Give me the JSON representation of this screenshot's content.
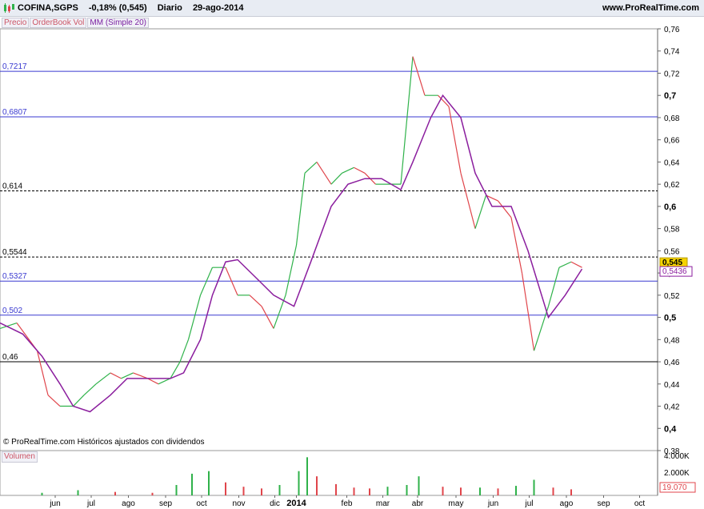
{
  "header": {
    "symbol": "COFINA,SGPS",
    "change": "-0,18% (0,545)",
    "period": "Diario",
    "date": "29-ago-2014",
    "site": "www.ProRealTime.com"
  },
  "tabs": [
    "Precio",
    "OrderBook Vol",
    "MM (Simple 20)"
  ],
  "credit": "© ProRealTime.com  Históricos ajustados con dividendos",
  "volume_tab": "Volumen",
  "colors": {
    "up": "#2fb24a",
    "down": "#e0454b",
    "ma": "#8b1e9e",
    "level": "#3a3ad0",
    "last": "#f5d400"
  },
  "chart_data": {
    "type": "line",
    "title": "COFINA,SGPS",
    "price_axis": {
      "min": 0.38,
      "max": 0.76,
      "ticks": [
        "0,76",
        "0,74",
        "0,72",
        "0,7",
        "0,68",
        "0,66",
        "0,64",
        "0,62",
        "0,6",
        "0,58",
        "0,56",
        "0,54",
        "0,52",
        "0,5",
        "0,48",
        "0,46",
        "0,44",
        "0,42",
        "0,4",
        "0,38"
      ],
      "tick_values": [
        0.76,
        0.74,
        0.72,
        0.7,
        0.68,
        0.66,
        0.64,
        0.62,
        0.6,
        0.58,
        0.56,
        0.54,
        0.52,
        0.5,
        0.48,
        0.46,
        0.44,
        0.42,
        0.4,
        0.38
      ]
    },
    "x_axis": {
      "labels": [
        "jun",
        "jul",
        "ago",
        "sep",
        "oct",
        "nov",
        "dic",
        "2014",
        "feb",
        "mar",
        "abr",
        "may",
        "jun",
        "jul",
        "ago",
        "sep",
        "oct"
      ],
      "range": [
        "2013-05-01",
        "2014-10-31"
      ]
    },
    "horizontal_levels": [
      {
        "label": "0,7217",
        "value": 0.7217,
        "style": "solid-blue"
      },
      {
        "label": "0,6807",
        "value": 0.6807,
        "style": "solid-blue"
      },
      {
        "label": "0,614",
        "value": 0.614,
        "style": "dashed-black"
      },
      {
        "label": "0,5544",
        "value": 0.5544,
        "style": "dashed-black"
      },
      {
        "label": "0,5327",
        "value": 0.5327,
        "style": "solid-blue"
      },
      {
        "label": "0,502",
        "value": 0.502,
        "style": "solid-blue"
      },
      {
        "label": "0,46",
        "value": 0.46,
        "style": "solid-black"
      }
    ],
    "last_price": {
      "label": "0,545",
      "value": 0.545
    },
    "last_ma": {
      "label": "0,5436",
      "value": 0.5436
    },
    "series": [
      {
        "name": "Precio",
        "x": [
          "2013-05-01",
          "2013-05-15",
          "2013-06-01",
          "2013-06-10",
          "2013-06-20",
          "2013-07-01",
          "2013-07-10",
          "2013-07-20",
          "2013-08-01",
          "2013-08-10",
          "2013-08-20",
          "2013-09-01",
          "2013-09-10",
          "2013-09-20",
          "2013-09-28",
          "2013-10-05",
          "2013-10-15",
          "2013-10-25",
          "2013-11-05",
          "2013-11-15",
          "2013-11-25",
          "2013-12-05",
          "2013-12-15",
          "2013-12-25",
          "2014-01-03",
          "2014-01-10",
          "2014-01-20",
          "2014-02-01",
          "2014-02-10",
          "2014-02-20",
          "2014-03-01",
          "2014-03-10",
          "2014-03-20",
          "2014-03-31",
          "2014-04-10",
          "2014-04-20",
          "2014-05-01",
          "2014-05-10",
          "2014-05-20",
          "2014-06-01",
          "2014-06-10",
          "2014-06-20",
          "2014-07-01",
          "2014-07-10",
          "2014-07-20",
          "2014-08-01",
          "2014-08-10",
          "2014-08-20",
          "2014-08-29"
        ],
        "values": [
          0.49,
          0.495,
          0.47,
          0.43,
          0.42,
          0.42,
          0.43,
          0.44,
          0.45,
          0.445,
          0.45,
          0.445,
          0.44,
          0.445,
          0.46,
          0.48,
          0.52,
          0.545,
          0.545,
          0.52,
          0.52,
          0.51,
          0.49,
          0.52,
          0.565,
          0.63,
          0.64,
          0.62,
          0.63,
          0.635,
          0.63,
          0.62,
          0.62,
          0.62,
          0.735,
          0.7,
          0.7,
          0.69,
          0.63,
          0.58,
          0.61,
          0.605,
          0.59,
          0.54,
          0.47,
          0.51,
          0.545,
          0.55,
          0.545
        ]
      },
      {
        "name": "MM (Simple 20)",
        "x": [
          "2013-05-01",
          "2013-05-20",
          "2013-06-05",
          "2013-06-20",
          "2013-07-01",
          "2013-07-15",
          "2013-08-01",
          "2013-08-15",
          "2013-09-01",
          "2013-09-20",
          "2013-10-01",
          "2013-10-15",
          "2013-10-25",
          "2013-11-05",
          "2013-11-15",
          "2013-12-01",
          "2013-12-15",
          "2014-01-01",
          "2014-01-15",
          "2014-02-01",
          "2014-02-15",
          "2014-03-01",
          "2014-03-15",
          "2014-03-31",
          "2014-04-10",
          "2014-04-25",
          "2014-05-05",
          "2014-05-20",
          "2014-06-01",
          "2014-06-15",
          "2014-07-01",
          "2014-07-15",
          "2014-08-01",
          "2014-08-15",
          "2014-08-29"
        ],
        "values": [
          0.495,
          0.485,
          0.465,
          0.44,
          0.42,
          0.415,
          0.43,
          0.445,
          0.445,
          0.445,
          0.45,
          0.48,
          0.52,
          0.55,
          0.552,
          0.535,
          0.52,
          0.51,
          0.55,
          0.6,
          0.62,
          0.625,
          0.625,
          0.615,
          0.64,
          0.68,
          0.7,
          0.68,
          0.63,
          0.6,
          0.6,
          0.56,
          0.5,
          0.52,
          0.5436
        ]
      }
    ],
    "volume": {
      "axis_ticks": [
        "4.000K",
        "2.000K"
      ],
      "last_label": "19.070",
      "x": [
        "2013-06-05",
        "2013-07-05",
        "2013-08-05",
        "2013-09-05",
        "2013-09-25",
        "2013-10-08",
        "2013-10-22",
        "2013-11-05",
        "2013-11-20",
        "2013-12-05",
        "2013-12-20",
        "2014-01-05",
        "2014-01-12",
        "2014-01-20",
        "2014-02-05",
        "2014-02-20",
        "2014-03-05",
        "2014-03-20",
        "2014-04-05",
        "2014-04-15",
        "2014-05-05",
        "2014-05-20",
        "2014-06-05",
        "2014-06-20",
        "2014-07-05",
        "2014-07-20",
        "2014-08-05",
        "2014-08-20"
      ],
      "values": [
        300,
        600,
        400,
        300,
        1200,
        2500,
        2800,
        1500,
        1000,
        800,
        1200,
        2800,
        4400,
        2200,
        1300,
        900,
        800,
        1000,
        1200,
        2200,
        1000,
        900,
        900,
        800,
        1100,
        1800,
        900,
        700
      ]
    }
  }
}
